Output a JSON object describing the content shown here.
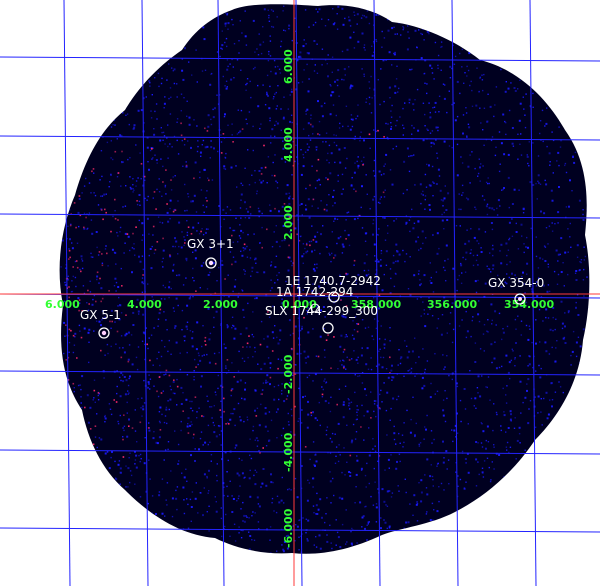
{
  "image": {
    "type": "x-ray sky map",
    "colors": {
      "background": "#ffffff",
      "sky_field": "#000020",
      "counts": "#1a1aff",
      "hot_counts": "#ff2a6a",
      "grid": "#2323ff",
      "axis": "#ff3a3a",
      "tick_labels": "#33ff33",
      "source_labels": "#ffffff"
    }
  },
  "axes": {
    "longitude_ticks": [
      "6.000",
      "4.000",
      "2.000",
      "0.000",
      "358.000",
      "356.000",
      "354.000"
    ],
    "latitude_ticks": [
      "6.000",
      "4.000",
      "2.000",
      "-2.000",
      "-4.000",
      "-6.000"
    ]
  },
  "sources": [
    {
      "name": "GX 3+1",
      "icon": "circle-marker-icon"
    },
    {
      "name": "1E 1740.7-2942",
      "icon": "circle-marker-icon"
    },
    {
      "name": "1A 1742-294",
      "icon": "circle-marker-icon"
    },
    {
      "name": "SLX 1744-299_300",
      "icon": "circle-marker-icon"
    },
    {
      "name": "GX 354-0",
      "icon": "circle-marker-icon"
    },
    {
      "name": "GX 5-1",
      "icon": "circle-marker-icon"
    }
  ]
}
